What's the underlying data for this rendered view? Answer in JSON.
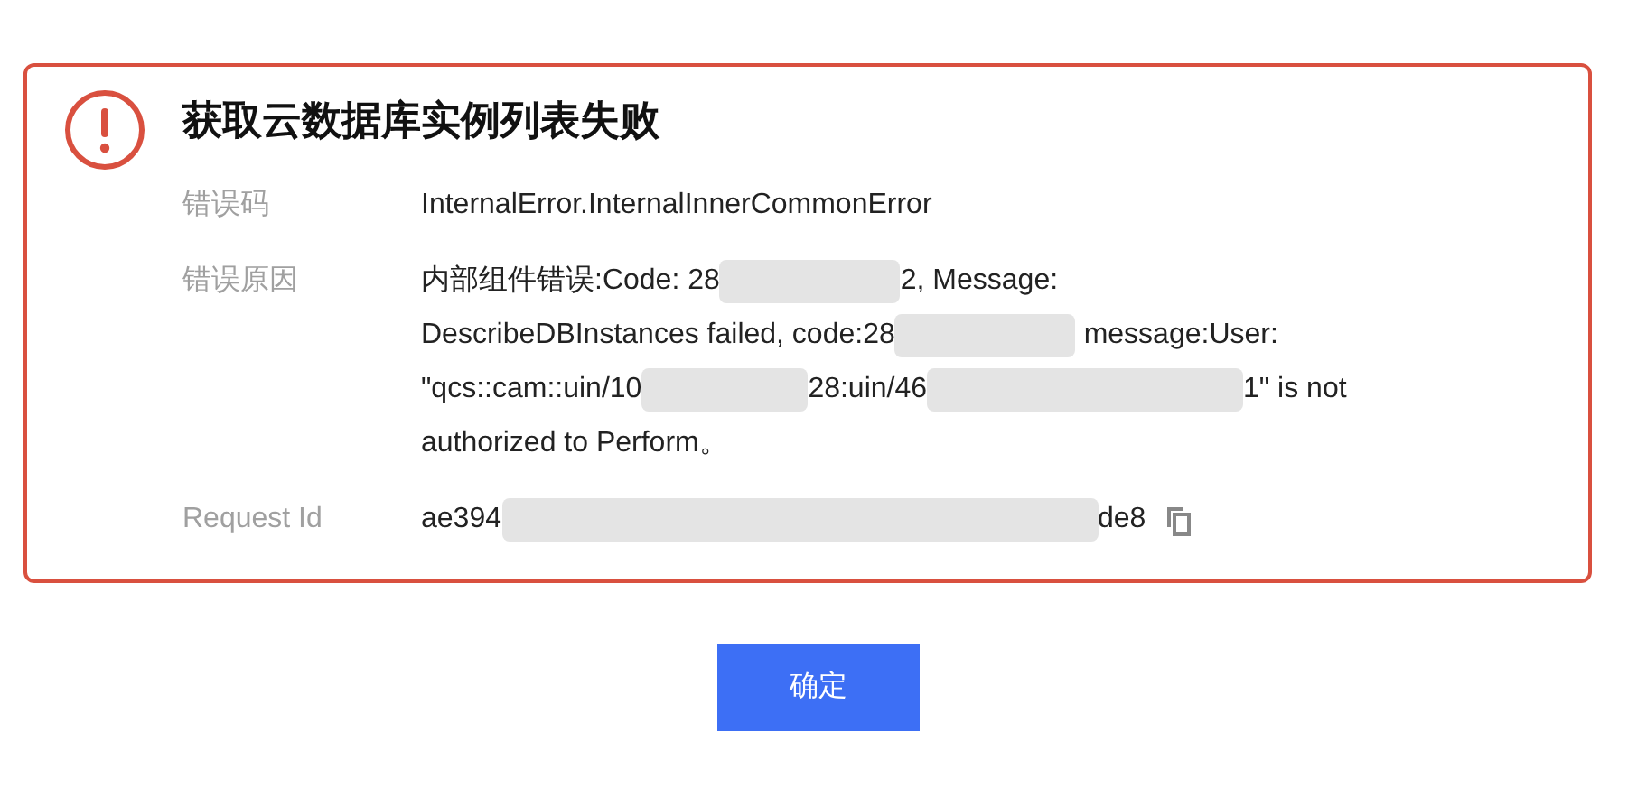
{
  "dialog": {
    "title": "获取云数据库实例列表失败",
    "fields": [
      {
        "label": "错误码",
        "lines": [
          [
            {
              "kind": "text",
              "text": "InternalError.InternalInnerCommonError"
            }
          ]
        ]
      },
      {
        "label": "错误原因",
        "lines": [
          [
            {
              "kind": "text",
              "text": "内部组件错误:Code: 28"
            },
            {
              "kind": "redacted"
            },
            {
              "kind": "text",
              "text": "2, Message:"
            }
          ],
          [
            {
              "kind": "text",
              "text": "DescribeDBInstances failed, code:28"
            },
            {
              "kind": "redacted"
            },
            {
              "kind": "text",
              "text": " message:User:"
            }
          ],
          [
            {
              "kind": "text",
              "text": "\"qcs::cam::uin/10"
            },
            {
              "kind": "redacted"
            },
            {
              "kind": "text",
              "text": "28:uin/46"
            },
            {
              "kind": "redacted"
            },
            {
              "kind": "text",
              "text": "1\" is not"
            }
          ],
          [
            {
              "kind": "text",
              "text": "authorized to Perform。"
            }
          ]
        ]
      },
      {
        "label": "Request Id",
        "copyable": true,
        "lines": [
          [
            {
              "kind": "text",
              "text": "ae394"
            },
            {
              "kind": "redacted"
            },
            {
              "kind": "text",
              "text": "de8"
            }
          ]
        ]
      }
    ],
    "confirm_button": "确定"
  }
}
